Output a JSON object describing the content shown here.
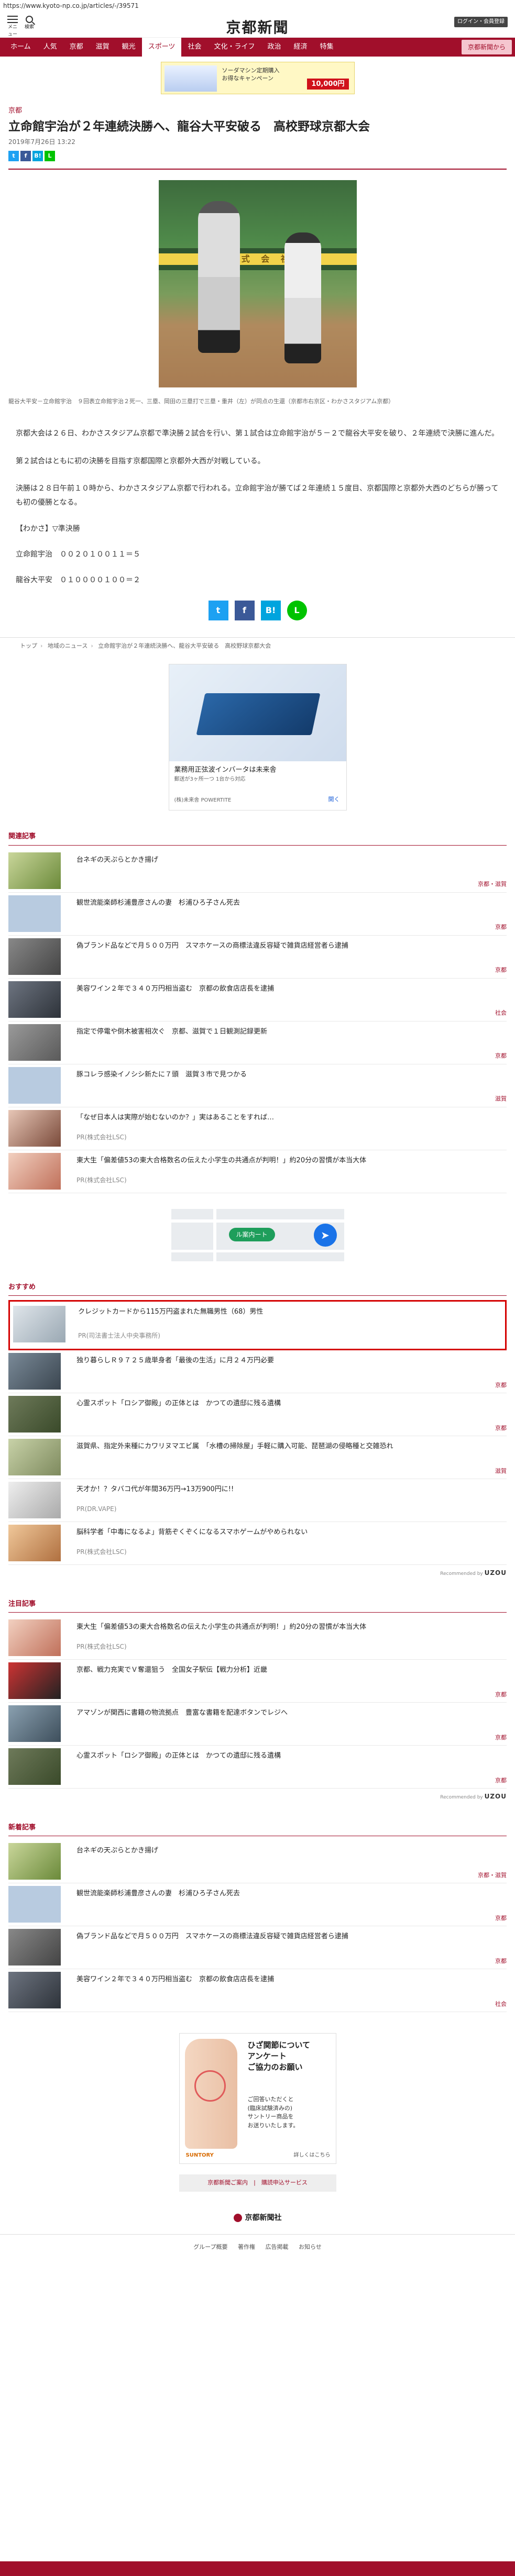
{
  "browser": {
    "url": "https://www.kyoto-np.co.jp/articles/-/39571"
  },
  "header": {
    "menu_label": "メニュー",
    "search_label": "検索",
    "logo": "京都新聞",
    "login_label": "ログイン・会員登録"
  },
  "nav": {
    "items": [
      "ホーム",
      "人気",
      "京都",
      "滋賀",
      "観光",
      "スポーツ",
      "社会",
      "文化・ライフ",
      "政治",
      "経済",
      "特集"
    ],
    "active": "スポーツ",
    "notice": "京都新聞から"
  },
  "top_ad": {
    "text": "ソーダマシン定期購入\nお得なキャンペーン",
    "price": "10,000円"
  },
  "article": {
    "section": "京都",
    "title": "立命館宇治が２年連続決勝へ、龍谷大平安破る　高校野球京都大会",
    "date": "2019年7月26日 13:22",
    "photo_board_text": "お 式 会 社",
    "caption": "龍谷大平安－立命館宇治　９回表立命館宇治２死一、三塁、岡田の三塁打で三塁・重井（左）が同点の生還（京都市右京区・わかさスタジアム京都）",
    "paragraphs": [
      "京都大会は２６日、わかさスタジアム京都で準決勝２試合を行い、第１試合は立命館宇治が５－２で龍谷大平安を破り、２年連続で決勝に進んだ。",
      "第２試合はともに初の決勝を目指す京都国際と京都外大西が対戦している。",
      "決勝は２８日午前１０時から、わかさスタジアム京都で行われる。立命館宇治が勝てば２年連続１５度目、京都国際と京都外大西のどちらが勝っても初の優勝となる。"
    ],
    "score_heading": "【わかさ】▽準決勝",
    "score_lines": [
      "立命館宇治　００２０１００１１＝５",
      "龍谷大平安　０１００００１００＝２"
    ]
  },
  "share": {
    "twitter": "t",
    "facebook": "f",
    "hatena": "B!",
    "line": "L"
  },
  "breadcrumb": [
    "トップ",
    "地域のニュース",
    "立命館宇治が２年連続決勝へ、龍谷大平安破る　高校野球京都大会"
  ],
  "mid_ad": {
    "title": "業務用正弦波インバータは未来舎",
    "subtitle": "郵送が3ヶ所一つ 1台から対応",
    "sponsor": "(株)未来舎 POWERTITE",
    "cta": "開く"
  },
  "related": {
    "heading": "関連記事",
    "rows": [
      {
        "title": "台ネギの天ぷらとかき揚げ",
        "tag": "京都・滋賀"
      },
      {
        "title": "観世流能楽師杉浦豊彦さんの妻　杉浦ひろ子さん死去",
        "tag": "京都"
      },
      {
        "title": "偽ブランド品などで月５００万円　スマホケースの商標法違反容疑で雑貨店経営者ら逮捕",
        "tag": "京都"
      },
      {
        "title": "美容ワイン２年で３４０万円相当盗む　京都の飲食店店長を逮捕",
        "tag": "社会"
      },
      {
        "title": "指定で停電や倒木被害相次ぐ　京都、滋賀で１日観測記録更新",
        "tag": "京都"
      },
      {
        "title": "豚コレラ感染イノシシ新たに７頭　滋賀３市で見つかる",
        "tag": "滋賀"
      },
      {
        "title": "「なぜ日本人は実際が始むないのか？」実はあることをすれば…",
        "sponsor": "PR(株式会社LSC)"
      },
      {
        "title": "東大生「偏差値53の東大合格数名の伝えた小学生の共通点が判明！」約20分の習慣が本当大体",
        "sponsor": "PR(株式会社LSC)"
      }
    ]
  },
  "map_ad": {
    "button": "ル案内ート",
    "dir_icon": "➤"
  },
  "osusume": {
    "heading": "おすすめ",
    "rows": [
      {
        "title": "クレジットカードから115万円盗まれた無職男性（68）男性",
        "sponsor": "PR(司法書士法人中央事務所)",
        "boxed": true
      },
      {
        "title": "独り暮らしＲ９７２５歳単身者「最後の生活」に月２４万円必要",
        "tag": "京都"
      },
      {
        "title": "心霊スポット「ロシア御殿」の正体とは　かつての遺邸に残る遺構",
        "tag": "京都"
      },
      {
        "title": "滋賀県、指定外来種にカワリヌマエビ属　「水槽の掃除屋」手軽に購入可能、琵琶湖の侵略種と交雑恐れ",
        "tag": "滋賀"
      },
      {
        "title": "天才か！？タバコ代が年間36万円→13万900円に!!",
        "sponsor": "PR(DR.VAPE)"
      },
      {
        "title": "脳科学者「中毒になるよ」背筋ぞくぞくになるスマホゲームがやめられない",
        "sponsor": "PR(株式会社LSC)"
      }
    ]
  },
  "chumoku": {
    "heading": "注目記事",
    "rows": [
      {
        "title": "東大生「偏差値53の東大合格数名の伝えた小学生の共通点が判明！」約20分の習慣が本当大体",
        "sponsor": "PR(株式会社LSC)"
      },
      {
        "title": "京都、戦力充実でＶ奪還狙う　全国女子駅伝【戦力分析】近畿",
        "tag": "京都"
      },
      {
        "title": "アマゾンが関西に書籍の物流拠点　豊富な書籍を配達ボタンでレジへ",
        "tag": "京都"
      },
      {
        "title": "心霊スポット「ロシア御殿」の正体とは　かつての遺邸に残る遺構",
        "tag": "京都"
      }
    ]
  },
  "shinchaku": {
    "heading": "新着記事",
    "rows": [
      {
        "title": "台ネギの天ぷらとかき揚げ",
        "tag": "京都・滋賀"
      },
      {
        "title": "観世流能楽師杉浦豊彦さんの妻　杉浦ひろ子さん死去",
        "tag": "京都"
      },
      {
        "title": "偽ブランド品などで月５００万円　スマホケースの商標法違反容疑で雑貨店経営者ら逮捕",
        "tag": "京都"
      },
      {
        "title": "美容ワイン２年で３４０万円相当盗む　京都の飲食店店長を逮捕",
        "tag": "社会"
      }
    ]
  },
  "recommended": {
    "label": "Recommended by",
    "brand": "UZOU"
  },
  "bottom_ad": {
    "headline": "ひざ関節について\nアンケート\nご協力のお願い",
    "sub": "ご回答いただくと\n(臨床試験済みの)\nサントリー商品を\nお送りいたします。",
    "brand": "SUNTORY",
    "more": "詳しくはこちら"
  },
  "footer": {
    "links": "京都新聞ご案内　|　購読申込サービス",
    "logo": "京都新聞社",
    "nav": [
      "グループ概要",
      "著作権",
      "広告掲載",
      "お知らせ"
    ]
  }
}
